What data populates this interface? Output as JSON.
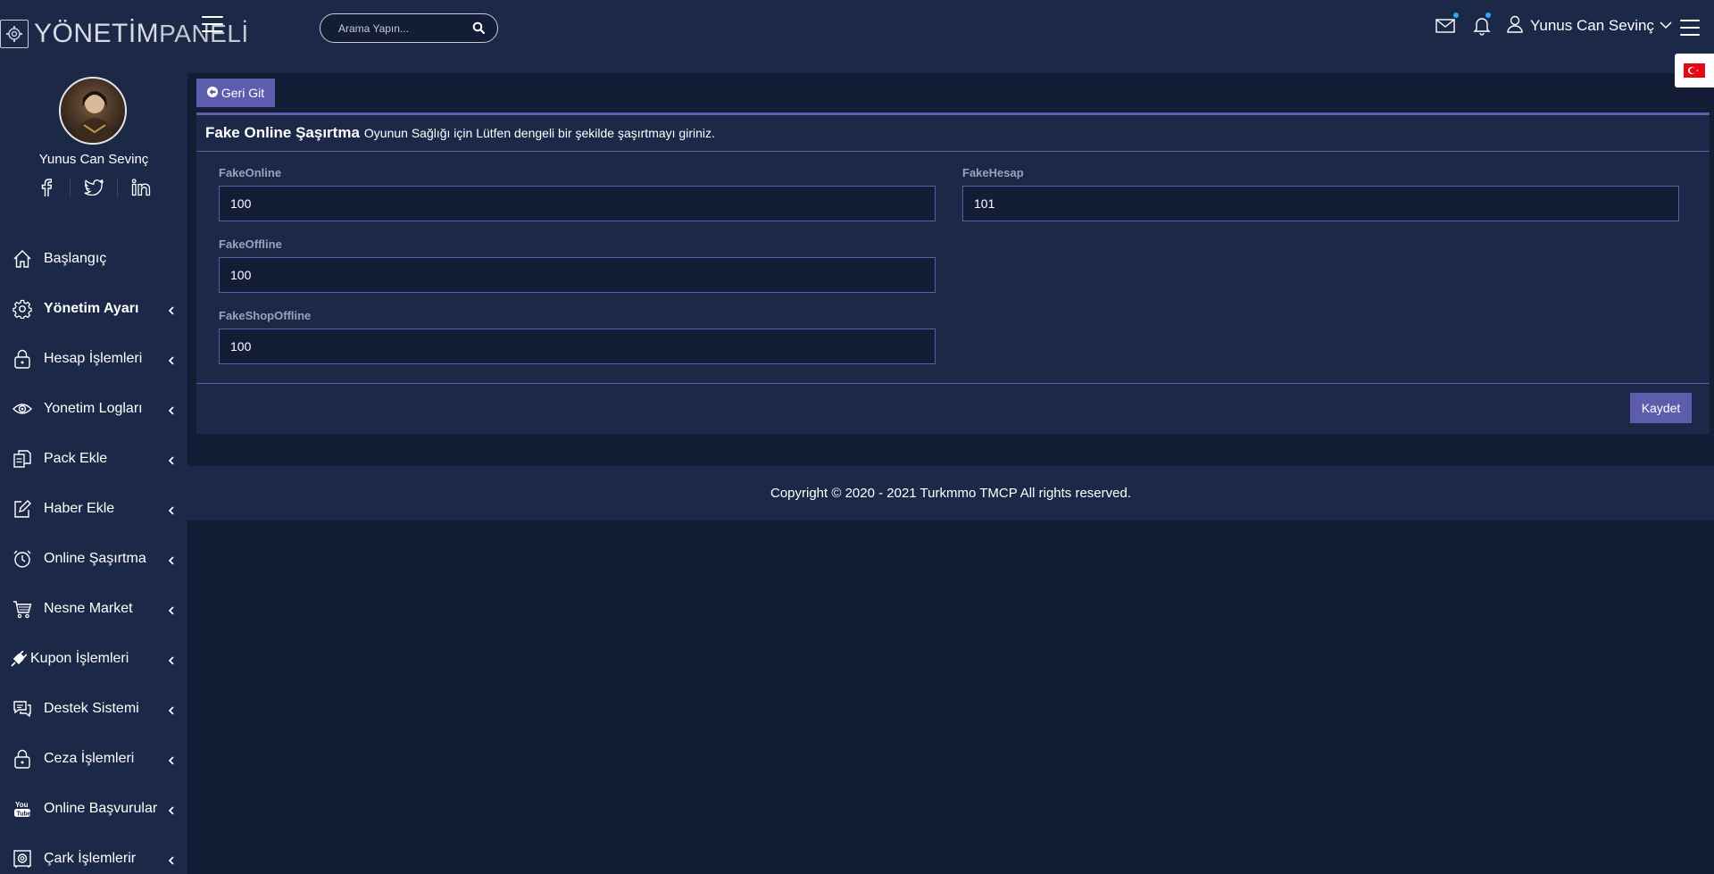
{
  "header": {
    "logo": {
      "bold": "YÖNETİM",
      "light": "PANELİ"
    },
    "search": {
      "placeholder": "Arama Yapın..."
    },
    "user_name": "Yunus Can Sevinç"
  },
  "sidebar": {
    "profile_name": "Yunus Can Sevinç",
    "socials": [
      "facebook-icon",
      "twitter-icon",
      "linkedin-icon"
    ],
    "items": [
      {
        "label": "Başlangıç",
        "icon": "home-icon",
        "bold": false,
        "has_submenu": false
      },
      {
        "label": "Yönetim Ayarı",
        "icon": "gear-icon",
        "bold": true,
        "has_submenu": true
      },
      {
        "label": "Hesap İşlemleri",
        "icon": "lock-icon",
        "bold": false,
        "has_submenu": true
      },
      {
        "label": "Yonetim Logları",
        "icon": "eye-icon",
        "bold": false,
        "has_submenu": true
      },
      {
        "label": "Pack Ekle",
        "icon": "files-icon",
        "bold": false,
        "has_submenu": true
      },
      {
        "label": "Haber Ekle",
        "icon": "edit-icon",
        "bold": false,
        "has_submenu": true
      },
      {
        "label": "Online Şaşırtma",
        "icon": "alarm-clock-icon",
        "bold": false,
        "has_submenu": true
      },
      {
        "label": "Nesne Market",
        "icon": "cart-icon",
        "bold": false,
        "has_submenu": true
      },
      {
        "label": "Kupon İşlemleri",
        "icon": "plug-icon",
        "bold": false,
        "has_submenu": true
      },
      {
        "label": "Destek Sistemi",
        "icon": "chat-icon",
        "bold": false,
        "has_submenu": true
      },
      {
        "label": "Ceza İşlemleri",
        "icon": "lock-icon",
        "bold": false,
        "has_submenu": true
      },
      {
        "label": "Online Başvurular",
        "icon": "youtube-icon",
        "bold": false,
        "has_submenu": true
      },
      {
        "label": "Çark İşlemlerir",
        "icon": "safe-icon",
        "bold": false,
        "has_submenu": true
      }
    ]
  },
  "main": {
    "back_label": "Geri Git",
    "card_title": "Fake Online Şaşırtma",
    "card_subtitle": "Oyunun Sağlığı için Lütfen dengeli bir şekilde şaşırtmayı giriniz.",
    "fields": {
      "fake_online": {
        "label": "FakeOnline",
        "value": "100"
      },
      "fake_hesap": {
        "label": "FakeHesap",
        "value": "101"
      },
      "fake_offline": {
        "label": "FakeOffline",
        "value": "100"
      },
      "fake_shop_offline": {
        "label": "FakeShopOffline",
        "value": "100"
      }
    },
    "save_label": "Kaydet"
  },
  "footer": {
    "copyright": "Copyright © 2020 - 2021 Turkmmo TMCP All rights reserved."
  },
  "colors": {
    "accent": "#5e5cad",
    "panel": "#1b2848",
    "background": "#141d36",
    "notif_dot": "#2fa6f0"
  }
}
